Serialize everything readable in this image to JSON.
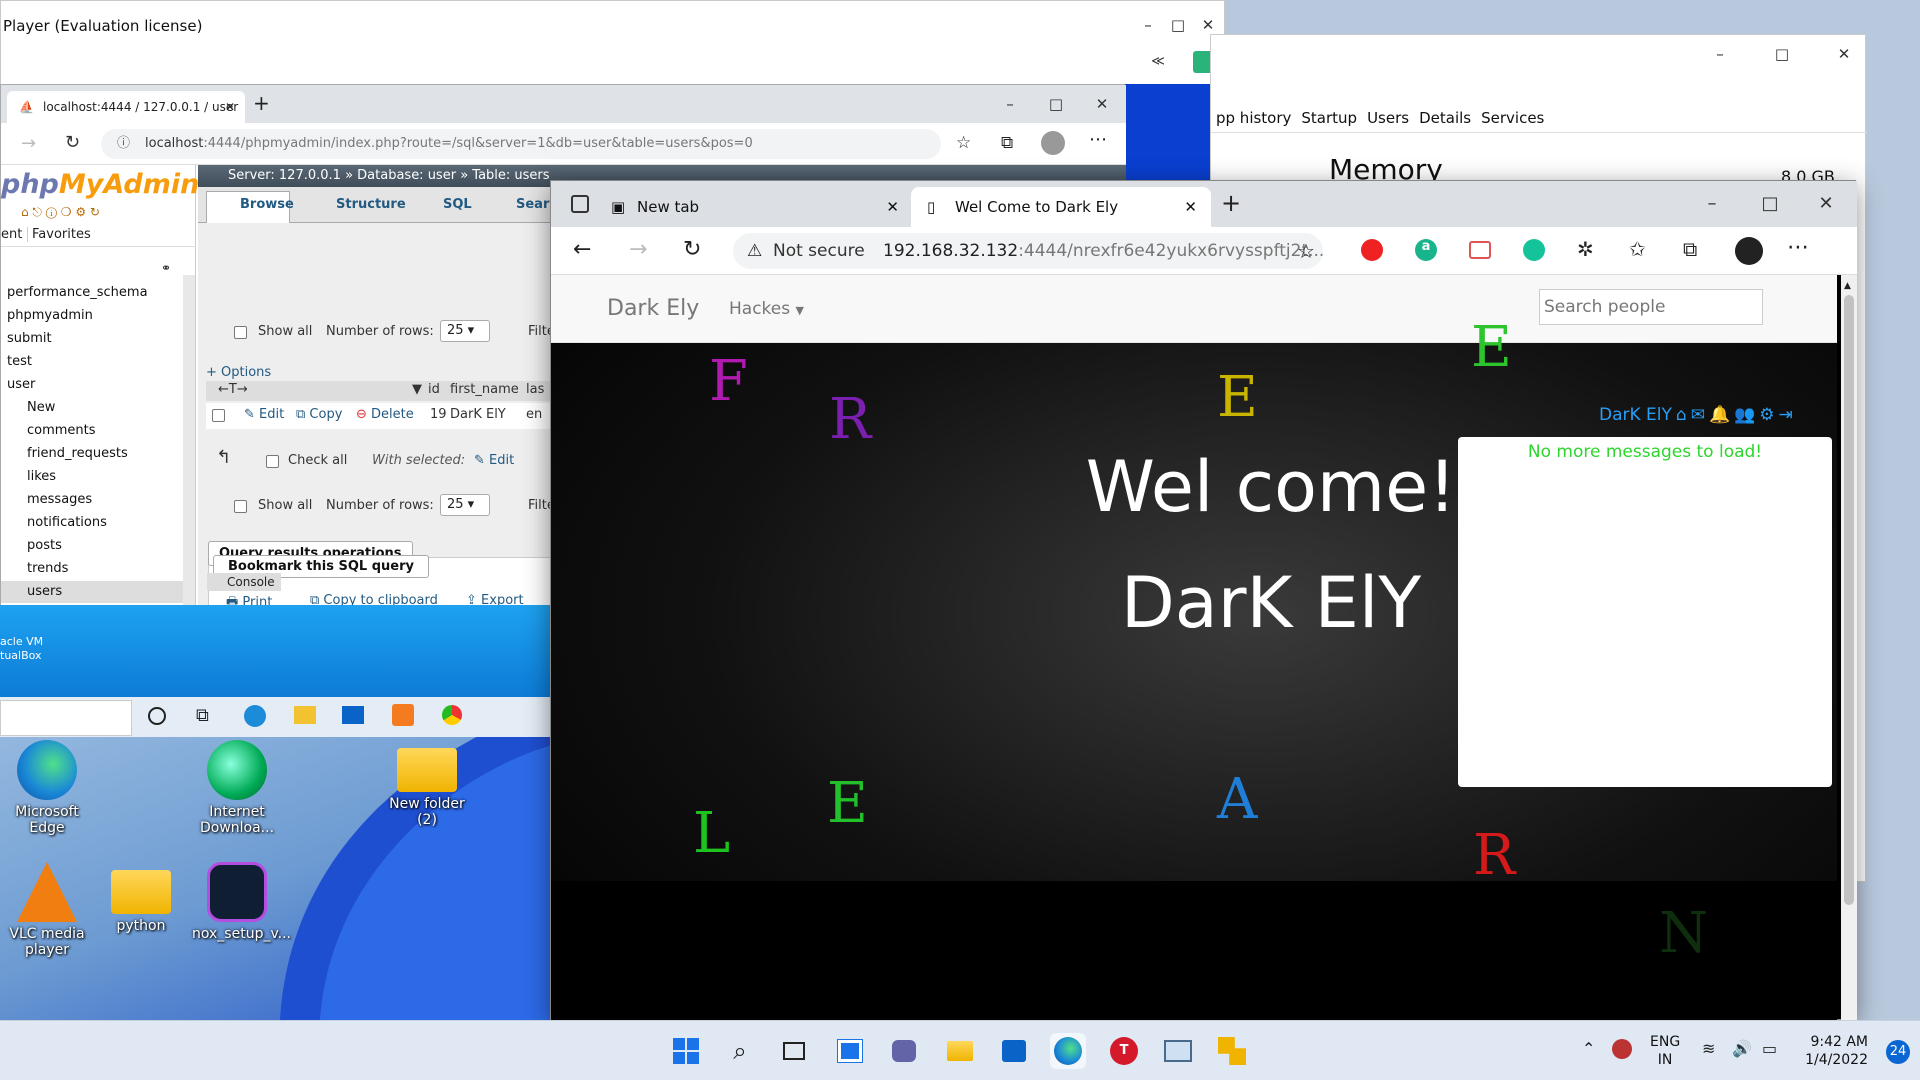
{
  "player": {
    "title": "Player (Evaluation license)"
  },
  "taskmgr": {
    "tabs": [
      "pp history",
      "Startup",
      "Users",
      "Details",
      "Services"
    ],
    "heading": "Memory",
    "value": "8.0 GB"
  },
  "pma": {
    "tab_title": "localhost:4444 / 127.0.0.1 / user",
    "url_host": "localhost",
    "url_rest": ":4444/phpmyadmin/index.php?route=/sql&server=1&db=user&table=users&pos=0",
    "logo_a": "php",
    "logo_b": "MyAdmin",
    "favorites": [
      "ent",
      "Favorites"
    ],
    "databases": [
      "performance_schema",
      "phpmyadmin",
      "submit",
      "test",
      "user"
    ],
    "tables": [
      "New",
      "comments",
      "friend_requests",
      "likes",
      "messages",
      "notifications",
      "posts",
      "trends",
      "users"
    ],
    "breadcrumb": [
      "Server: 127.0.0.1",
      "Database: user",
      "Table: users"
    ],
    "tabs": [
      "Browse",
      "Structure",
      "SQL",
      "Searc"
    ],
    "show_all": "Show all",
    "num_rows_label": "Number of rows:",
    "num_rows_value": "25",
    "filter": "Filte",
    "options": "+ Options",
    "col_headers": [
      "id",
      "first_name",
      "las"
    ],
    "row": {
      "edit": "Edit",
      "copy": "Copy",
      "delete": "Delete",
      "id": "19",
      "first_name": "DarK ElY",
      "last": "en"
    },
    "check_all": "Check all",
    "with_selected": "With selected:",
    "edit": "Edit",
    "query_ops": "Query results operations",
    "print": "Print",
    "copy_clip": "Copy to clipboard",
    "export": "Export",
    "bookmark": "Bookmark this SQL query",
    "console": "Console"
  },
  "vm": {
    "vb_label": [
      "acle VM",
      "tualBox"
    ],
    "icons": [
      {
        "label": "Microsoft Edge"
      },
      {
        "label": "Internet Downloa..."
      },
      {
        "label": "New folder (2)"
      },
      {
        "label": "VLC media player"
      },
      {
        "label": "python"
      },
      {
        "label": "nox_setup_v..."
      }
    ]
  },
  "edge": {
    "tab1": "New tab",
    "tab2": "Wel Come to Dark Ely",
    "not_secure": "Not secure",
    "url_host": "192.168.32.132",
    "url_rest": ":4444/nrexfr6e42yukx6rvysspftj2t...",
    "site": {
      "brand": "Dark Ely",
      "menu": "Hackes",
      "search_placeholder": "Search people",
      "user": "DarK ElY",
      "no_more": "No more messages to load!",
      "welcome1": "Wel come!",
      "welcome2": "DarK ElY",
      "letters": [
        {
          "ch": "F",
          "color": "#b01ab0"
        },
        {
          "ch": "R",
          "color": "#7a1fb0"
        },
        {
          "ch": "E",
          "color": "#c9b400"
        },
        {
          "ch": "E",
          "color": "#2ec42e"
        },
        {
          "ch": "L",
          "color": "#1ec41e"
        },
        {
          "ch": "E",
          "color": "#22c02a"
        },
        {
          "ch": "A",
          "color": "#1f7fd6"
        },
        {
          "ch": "R",
          "color": "#d41a1a"
        },
        {
          "ch": "N",
          "color": "#0e2e0e"
        }
      ]
    }
  },
  "taskbar": {
    "lang1": "ENG",
    "lang2": "IN",
    "time": "9:42 AM",
    "date": "1/4/2022",
    "notif": "24"
  }
}
